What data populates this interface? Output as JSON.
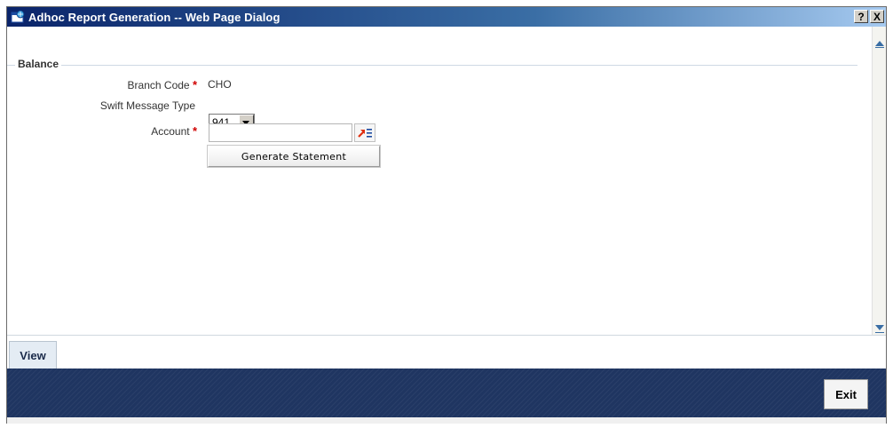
{
  "window": {
    "title": "Adhoc Report Generation -- Web Page Dialog",
    "help_label": "?",
    "close_label": "X"
  },
  "form": {
    "section_title": "Balance",
    "branch_code_label": "Branch Code",
    "branch_code_value": "CHO",
    "swift_type_label": "Swift Message Type",
    "swift_type_value": "941",
    "account_label": "Account",
    "account_value": "",
    "required_marker": "*",
    "generate_label": "Generate Statement"
  },
  "tabs": [
    {
      "label": "View"
    }
  ],
  "footer": {
    "exit_label": "Exit"
  },
  "colors": {
    "titlebar": "#0a246a",
    "bottombar": "#1f3561",
    "required": "#d00000"
  },
  "icons": [
    "window-app-icon",
    "help-icon",
    "close-icon",
    "dropdown-arrow-icon",
    "list-of-values-icon",
    "scroll-up-arrow-icon",
    "scroll-down-arrow-icon"
  ]
}
